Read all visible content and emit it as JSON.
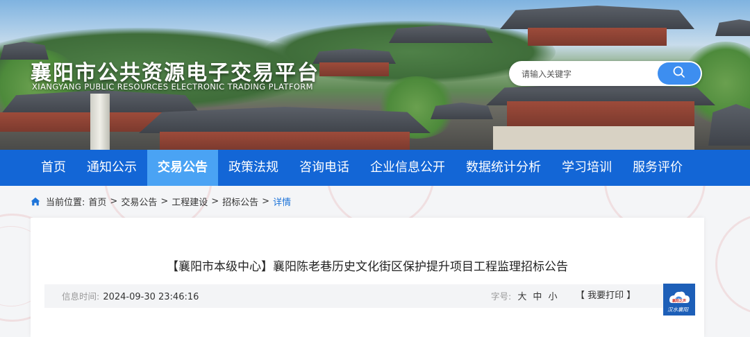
{
  "header": {
    "title": "襄阳市公共资源电子交易平台",
    "subtitle": "XIANGYANG PUBLIC RESOURCES ELECTRONIC TRADING PLATFORM",
    "search_placeholder": "请输入关键字",
    "search_icon": "search-icon"
  },
  "nav": {
    "items": [
      {
        "label": "首页"
      },
      {
        "label": "通知公示"
      },
      {
        "label": "交易公告",
        "active": true
      },
      {
        "label": "政策法规"
      },
      {
        "label": "咨询电话"
      },
      {
        "label": "企业信息公开"
      },
      {
        "label": "数据统计分析"
      },
      {
        "label": "学习培训"
      },
      {
        "label": "服务评价"
      }
    ],
    "colors": {
      "bar": "#1366d6",
      "active": "#4aa3f4"
    }
  },
  "breadcrumb": {
    "home_icon": "home-icon",
    "prefix": "当前位置:",
    "items": [
      "首页",
      "交易公告",
      "工程建设",
      "招标公告"
    ],
    "separator": ">",
    "current": "详情"
  },
  "article": {
    "title": "【襄阳市本级中心】襄阳陈老巷历史文化街区保护提升项目工程监理招标公告",
    "info_time_label": "信息时间:",
    "info_time_value": "2024-09-30 23:46:16",
    "font_size_label": "字号:",
    "font_sizes": [
      "大",
      "中",
      "小"
    ],
    "print_label": "【 我要打印 】"
  },
  "logo": {
    "line1": "襄阳之声",
    "line2": "汉水襄阳"
  }
}
